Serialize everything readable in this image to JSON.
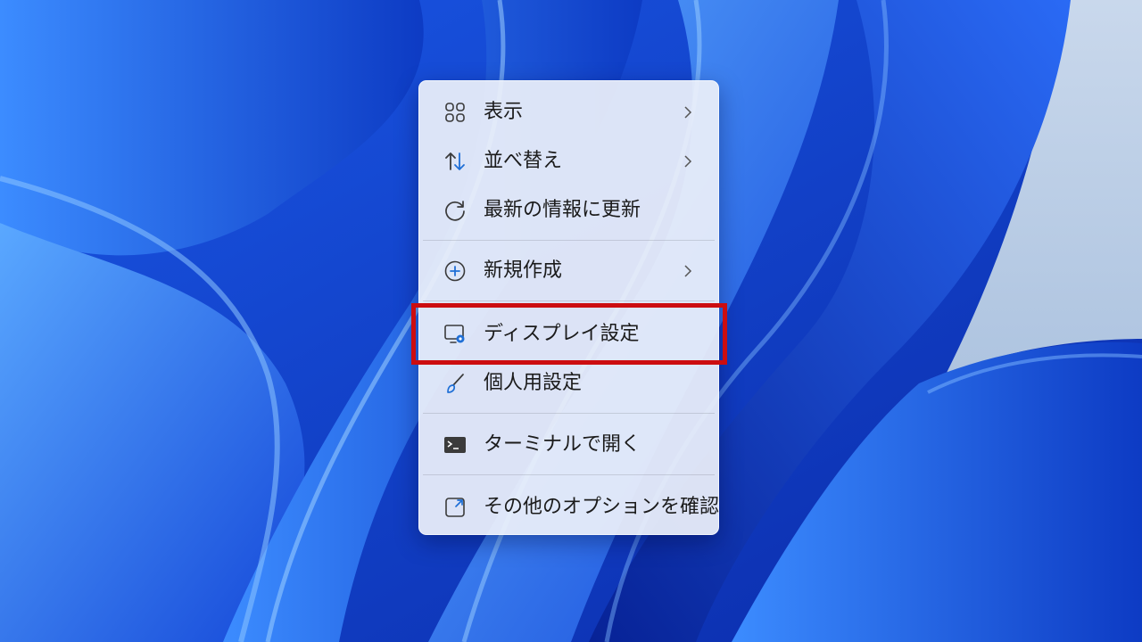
{
  "desktop": {
    "wallpaper": "windows-11-bloom-blue",
    "accent_color": "#1f4fd6"
  },
  "context_menu": {
    "items": [
      {
        "label": "表示",
        "icon": "view-grid-icon",
        "has_submenu": true
      },
      {
        "label": "並べ替え",
        "icon": "sort-arrows-icon",
        "has_submenu": true
      },
      {
        "label": "最新の情報に更新",
        "icon": "refresh-icon",
        "has_submenu": false
      },
      {
        "label": "新規作成",
        "icon": "new-plus-icon",
        "has_submenu": true
      },
      {
        "label": "ディスプレイ設定",
        "icon": "display-settings-icon",
        "has_submenu": false,
        "highlighted": true
      },
      {
        "label": "個人用設定",
        "icon": "brush-icon",
        "has_submenu": false
      },
      {
        "label": "ターミナルで開く",
        "icon": "terminal-icon",
        "has_submenu": false
      },
      {
        "label": "その他のオプションを確認",
        "icon": "more-options-icon",
        "has_submenu": false
      }
    ]
  },
  "annotation": {
    "highlight_color": "#cc0d10",
    "highlighted_item": "ディスプレイ設定"
  }
}
